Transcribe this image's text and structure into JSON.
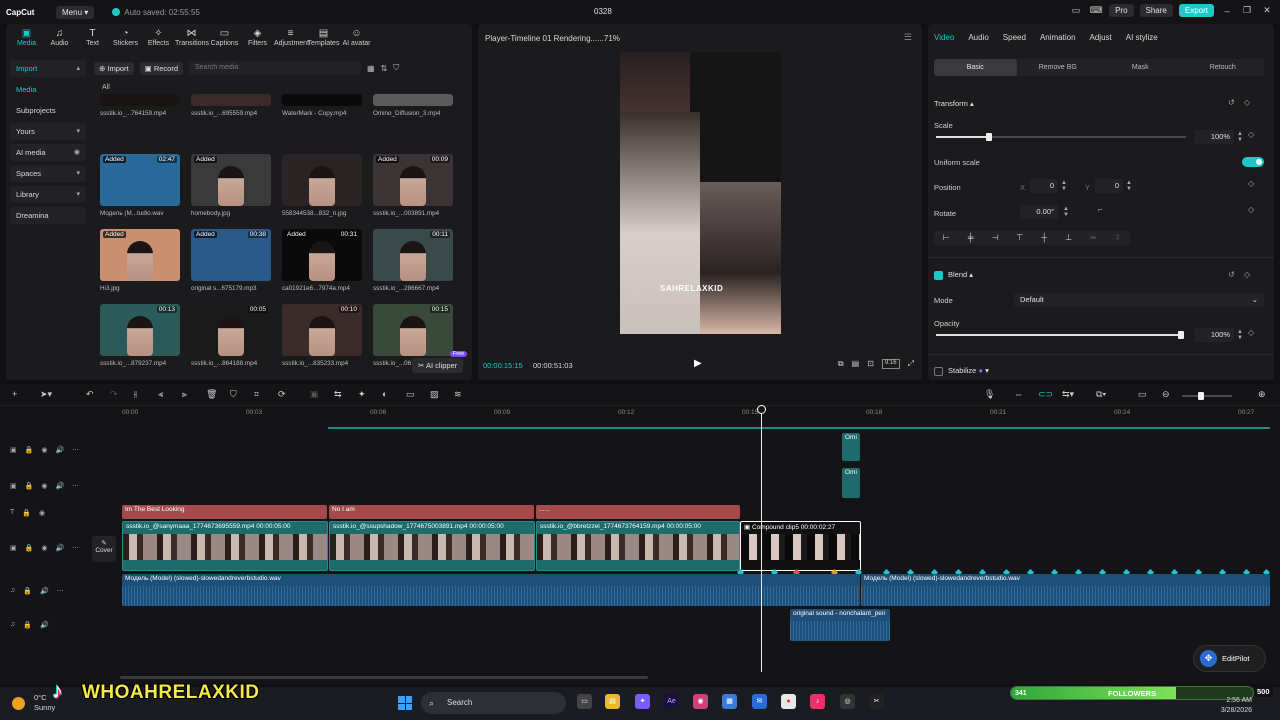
{
  "app": {
    "logo": "CapCut",
    "menu_label": "Menu",
    "autosave": "Auto saved: 02:55:55",
    "project_title": "0328",
    "pro_label": "Pro",
    "share_label": "Share",
    "export_label": "Export"
  },
  "toolbar": {
    "tools": [
      "Media",
      "Audio",
      "Text",
      "Stickers",
      "Effects",
      "Transitions",
      "Captions",
      "Filters",
      "Adjustment",
      "Templates",
      "AI avatar"
    ]
  },
  "media_nav": {
    "items": [
      "Import",
      "Media",
      "Subprojects",
      "Yours",
      "AI media",
      "Spaces",
      "Library",
      "Dreamina"
    ]
  },
  "media_toolbar": {
    "import_label": "Import",
    "record_label": "Record",
    "search_placeholder": "Search media",
    "all_label": "All"
  },
  "media_tiles": [
    {
      "caption": "ssstik.io_...764159.mp4",
      "added": "",
      "duration": ""
    },
    {
      "caption": "ssstik.io_...695559.mp4",
      "added": "",
      "duration": ""
    },
    {
      "caption": "WaterMark - Copy.mp4",
      "added": "",
      "duration": ""
    },
    {
      "caption": "Omino_Diffusion_3.mp4",
      "added": "",
      "duration": ""
    },
    {
      "caption": "Модель (M...tudio.wav",
      "added": "Added",
      "duration": "02:47"
    },
    {
      "caption": "homebody.jpg",
      "added": "Added",
      "duration": ""
    },
    {
      "caption": "558344538...832_n.jpg",
      "added": "",
      "duration": ""
    },
    {
      "caption": "ssstik.io_...003891.mp4",
      "added": "Added",
      "duration": "00:09"
    },
    {
      "caption": "Hi3.jpg",
      "added": "Added",
      "duration": ""
    },
    {
      "caption": "original s...675179.mp3",
      "added": "Added",
      "duration": "00:38"
    },
    {
      "caption": "ca01921e6...7974a.mp4",
      "added": "Added",
      "duration": "00:31"
    },
    {
      "caption": "ssstik.io_...286667.mp4",
      "added": "",
      "duration": "00:11"
    },
    {
      "caption": "ssstik.io_...879237.mp4",
      "added": "",
      "duration": "00:13"
    },
    {
      "caption": "ssstik.io_...864188.mp4",
      "added": "",
      "duration": "00:05"
    },
    {
      "caption": "ssstik.io_...835233.mp4",
      "added": "",
      "duration": "00:10"
    },
    {
      "caption": "ssstik.io_...061879.mp4",
      "added": "",
      "duration": "00:15"
    }
  ],
  "ai_clipper": {
    "label": "AI clipper",
    "badge": "Free"
  },
  "player": {
    "title": "Player-Timeline 01 Rendering......71%",
    "watermark": "SAHRELAXKID",
    "current_time": "00:00:15:15",
    "total_time": "00:00:51:03",
    "ratio_label": "9:16"
  },
  "props": {
    "tabs": [
      "Video",
      "Audio",
      "Speed",
      "Animation",
      "Adjust",
      "AI stylize"
    ],
    "subtabs": [
      "Basic",
      "Remove BG",
      "Mask",
      "Retouch"
    ],
    "transform_title": "Transform",
    "scale_label": "Scale",
    "scale_value": "100%",
    "scale_level": 1.0,
    "uniform_scale_label": "Uniform scale",
    "position_label": "Position",
    "pos_x_label": "X",
    "pos_x": "0",
    "pos_y_label": "Y",
    "pos_y": "0",
    "rotate_label": "Rotate",
    "rotate_value": "0.00°",
    "blend_title": "Blend",
    "mode_label": "Mode",
    "mode_value": "Default",
    "opacity_label": "Opacity",
    "opacity_value": "100%",
    "stabilize_label": "Stabilize"
  },
  "timeline": {
    "ticks": [
      "00:00",
      "00:03",
      "00:06",
      "00:09",
      "00:12",
      "00:15",
      "00:18",
      "00:21",
      "00:24",
      "00:27"
    ],
    "text_clips": [
      "Im The Best Looking",
      "No I am",
      "......"
    ],
    "video_clips": [
      {
        "name": "ssstik.io_@sanymaaa_1774673695559.mp4",
        "dur": "00:00:05:00"
      },
      {
        "name": "ssstik.io_@ssupshadow_1774675003891.mp4",
        "dur": "00:00:05:00"
      },
      {
        "name": "ssstik.io_@bbretzzel_1774673764159.mp4",
        "dur": "00:00:05:00"
      },
      {
        "name": "Compound clip5",
        "dur": "00:00:02:27"
      }
    ],
    "overlay_clip_label": "Omi",
    "audio_main": "Модель (Model) (slowed)-slowedandreverbstudio.wav",
    "audio_main2": "Модель (Model) (slowed)-slowedandreverbstudio.wav",
    "audio_secondary": "original sound - nonchalant_pen",
    "cover_label": "Cover"
  },
  "editpilot": {
    "label": "EditPilot"
  },
  "taskbar": {
    "temp": "0°C",
    "weather": "Sunny",
    "search": "Search",
    "followers_label": "FOLLOWERS",
    "followers_current": "341",
    "followers_goal": "500",
    "followers_progress": 0.68,
    "time": "2:56 AM",
    "date": "3/28/2026"
  },
  "overlay": {
    "name": "WHOAHRELAXKID"
  },
  "colors": {
    "accent": "#1fc8c8",
    "text_clip": "#a44a4a",
    "video_track": "#1f6b6b",
    "audio_track": "#1d4f78"
  }
}
